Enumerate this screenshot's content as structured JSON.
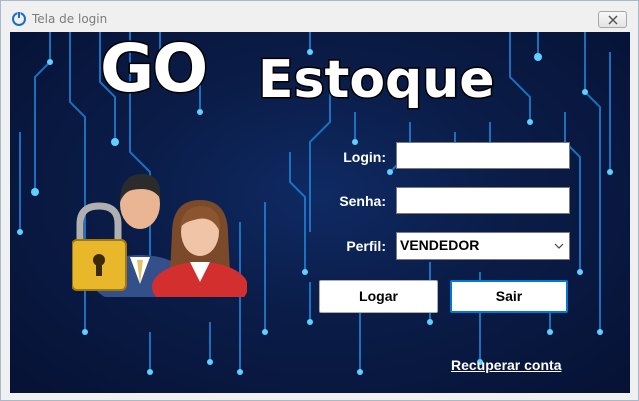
{
  "window": {
    "title": "Tela de login",
    "app_icon": "power-icon",
    "close_icon": "close-icon"
  },
  "logo": {
    "part1": "GO",
    "part2": "Estoque"
  },
  "form": {
    "login_label": "Login:",
    "login_value": "",
    "senha_label": "Senha:",
    "senha_value": "",
    "perfil_label": "Perfil:",
    "perfil_value": "VENDEDOR"
  },
  "buttons": {
    "logar": "Logar",
    "sair": "Sair"
  },
  "link": {
    "recover": "Recuperar conta"
  },
  "colors": {
    "background": "#0a1c47",
    "circuit": "#1f7fd6",
    "circuit_node": "#5fd0ff",
    "focus": "#0078d7"
  }
}
